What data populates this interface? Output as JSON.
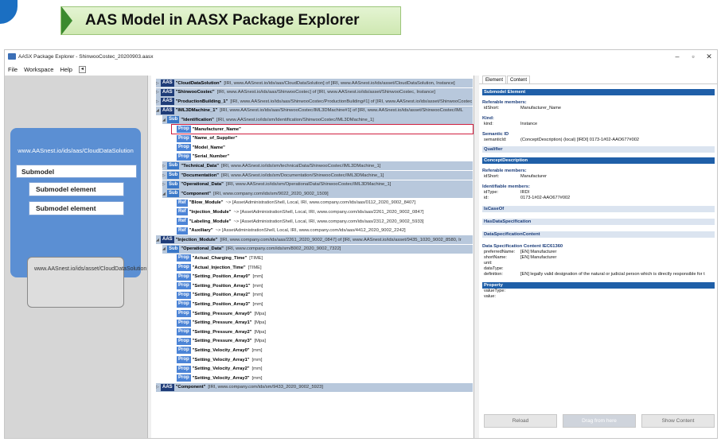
{
  "banner": {
    "title": "AAS Model in AASX Package Explorer"
  },
  "window": {
    "title": "AASX Package Explorer - ShinwooCostec_20200903.aasx",
    "menu": [
      "File",
      "Workspace",
      "Help"
    ],
    "nav_glyph": "◂"
  },
  "diagram": {
    "aas_id": "www.AASnest.io/ids/aas/CloudDataSolution",
    "submodel": "Submodel",
    "element1": "Submodel element",
    "element2": "Submodel element",
    "asset_id": "www.AASnest.io/ids/asset/CloudDataSolution"
  },
  "tree": {
    "rows": [
      {
        "badge": "AAS",
        "name": "\"CloudDataSolution\"",
        "detail": "[IRI, www.AASnest.io/ids/aas/CloudDataSolution] of [IRI, www.AASnest.io/ids/asset/CloudDataSolution, Instance]"
      },
      {
        "badge": "AAS",
        "name": "\"ShinwooCostec\"",
        "detail": "[IRI, www.AASnest.io/ids/aas/ShinwooCostec] of [IRI, www.AASnest.io/ids/asset/ShinwooCostec, Instance]"
      },
      {
        "badge": "AAS",
        "name": "\"ProductionBuilding_1\"",
        "detail": "[IRI, www.AASnest.io/ids/aas/ShinwooCostec/ProductionBuilding#1] of [IRI, www.AASnest.io/ids/asset/ShinwooCostec"
      },
      {
        "badge": "AAS",
        "name": "\"IML3DMachine_1\"",
        "detail": "[IRI, www.AASnest.io/ids/aas/ShinwooCostec/IML3DMachine#1] of [IRI, www.AASnest.io/ids/asset/ShinwooCostec/IML"
      },
      {
        "badge": "Sub",
        "name": "\"Identification\"",
        "detail": "[IRI, www.AASnest.io/ids/sm/Identification/ShinwooCostec/IML3DMachine_1]"
      },
      {
        "badge": "Prop",
        "name": "\"Manufacturer_Name\"",
        "detail": ""
      },
      {
        "badge": "Prop",
        "name": "\"Name_of_Supplier\"",
        "detail": ""
      },
      {
        "badge": "Prop",
        "name": "\"Model_Name\"",
        "detail": ""
      },
      {
        "badge": "Prop",
        "name": "\"Serial_Number\"",
        "detail": ""
      },
      {
        "badge": "Sub",
        "name": "\"Technical_Data\"",
        "detail": "[IRI, www.AASnest.io/ids/sm/technicalData/ShinwooCostec/IML3DMachine_1]"
      },
      {
        "badge": "Sub",
        "name": "\"Documentation\"",
        "detail": "[IRI, www.AASnest.io/ids/sm/Documentation/ShinwooCostec/IML3DMachine_1]"
      },
      {
        "badge": "Sub",
        "name": "\"Operational_Data\"",
        "detail": "[IRI, www.AASnest.io/ids/sm/OperationalData/ShinwooCostec/IML3DMachine_1]"
      },
      {
        "badge": "Sub",
        "name": "\"Component\"",
        "detail": "[IRI, www.company.com/ids/sm/9022_2020_9002_1509]"
      },
      {
        "badge": "Ref",
        "name": "\"Blow_Module\"",
        "detail": "~> [AssetAdministrationShell, Local, IRI, www.company.com/ids/aas/0112_2020_9002_8407]"
      },
      {
        "badge": "Ref",
        "name": "\"Injection_Module\"",
        "detail": "~> [AssetAdministrationShell, Local, IRI, www.company.com/ids/aas/2261_2020_9002_0847]"
      },
      {
        "badge": "Ref",
        "name": "\"Labeling_Module\"",
        "detail": "~> [AssetAdministrationShell, Local, IRI, www.company.com/ids/aas/2312_2020_9002_5933]"
      },
      {
        "badge": "Ref",
        "name": "\"Auxiliary\"",
        "detail": "~> [AssetAdministrationShell, Local, IRI, www.company.com/ids/aas/4412_2020_9002_2242]"
      },
      {
        "badge": "AAS",
        "name": "\"Injection_Module\"",
        "detail": "[IRI, www.company.com/ids/aas/2261_2020_9002_0847] of [IRI, www.AASnest.io/ids/asset/9435_1020_9002_8580, Ir"
      },
      {
        "badge": "Sub",
        "name": "\"Operational_Data\"",
        "detail": "[IRI, www.company.com/ids/sm/8002_2020_9002_7322]"
      },
      {
        "badge": "Prop",
        "name": "\"Actual_Charging_Time\"",
        "detail": "[TIME]"
      },
      {
        "badge": "Prop",
        "name": "\"Actual_Injection_Time\"",
        "detail": "[TIME]"
      },
      {
        "badge": "Prop",
        "name": "\"Setting_Position_Array0\"",
        "detail": "[mm]"
      },
      {
        "badge": "Prop",
        "name": "\"Setting_Position_Array1\"",
        "detail": "[mm]"
      },
      {
        "badge": "Prop",
        "name": "\"Setting_Position_Array2\"",
        "detail": "[mm]"
      },
      {
        "badge": "Prop",
        "name": "\"Setting_Position_Array3\"",
        "detail": "[mm]"
      },
      {
        "badge": "Prop",
        "name": "\"Setting_Pressure_Array0\"",
        "detail": "[Mpa]"
      },
      {
        "badge": "Prop",
        "name": "\"Setting_Pressure_Array1\"",
        "detail": "[Mpa]"
      },
      {
        "badge": "Prop",
        "name": "\"Setting_Pressure_Array2\"",
        "detail": "[Mpa]"
      },
      {
        "badge": "Prop",
        "name": "\"Setting_Pressure_Array3\"",
        "detail": "[Mpa]"
      },
      {
        "badge": "Prop",
        "name": "\"Setting_Velocity_Array0\"",
        "detail": "[mm]"
      },
      {
        "badge": "Prop",
        "name": "\"Setting_Velocity_Array1\"",
        "detail": "[mm]"
      },
      {
        "badge": "Prop",
        "name": "\"Setting_Velocity_Array2\"",
        "detail": "[mm]"
      },
      {
        "badge": "Prop",
        "name": "\"Setting_Velocity_Array3\"",
        "detail": "[mm]"
      },
      {
        "badge": "AAS",
        "name": "\"Component\"",
        "detail": "[IRI, www.company.com/ids/sm/9433_2020_9002_5923]"
      }
    ]
  },
  "panel": {
    "tab_element": "Element",
    "tab_content": "Content",
    "h_submodel_element": "Submodel Element",
    "h_referable": "Referable members:",
    "idshort_k": "idShort:",
    "idshort_v": "Manufacturer_Name",
    "h_kind": "Kind:",
    "kind_k": "kind:",
    "kind_v": "Instance",
    "h_semantic": "Semantic ID",
    "semid_k": "semanticId:",
    "semid_v": "(ConceptDescription) (local) [IRDI] 0173-1#02-AAO677#002",
    "h_qualifier": "Qualifier",
    "h_concept": "ConceptDescription",
    "h_referable2": "Referable members:",
    "idshort2_k": "idShort:",
    "idshort2_v": "Manufacturer",
    "h_identifiable": "Identifiable members:",
    "idtype_k": "idType:",
    "idtype_v": "IRDI",
    "id_k": "id:",
    "id_v": "0173-1#02-AAO677#002",
    "h_iscaseof": "IsCaseOf",
    "h_hasds": "HasDataSpecification",
    "h_dscontent": "DataSpecificationContent",
    "h_iec": "Data Specification Content IEC61360",
    "pref_k": "preferredName:",
    "pref_v": "[EN] Manufacturer",
    "short_k": "shortName:",
    "short_v": "[EN] Manufacturer",
    "unit_k": "unit:",
    "unit_v": "",
    "dtype_k": "dataType:",
    "dtype_v": "",
    "def_k": "definition:",
    "def_v": "[EN] legally valid designation of the natural or judicial person which is directly responsible for t",
    "h_property": "Property",
    "vtype_k": "valueType:",
    "value_k": "value:",
    "btn_reload": "Reload",
    "btn_drag": "Drag from here",
    "btn_show": "Show Content"
  }
}
